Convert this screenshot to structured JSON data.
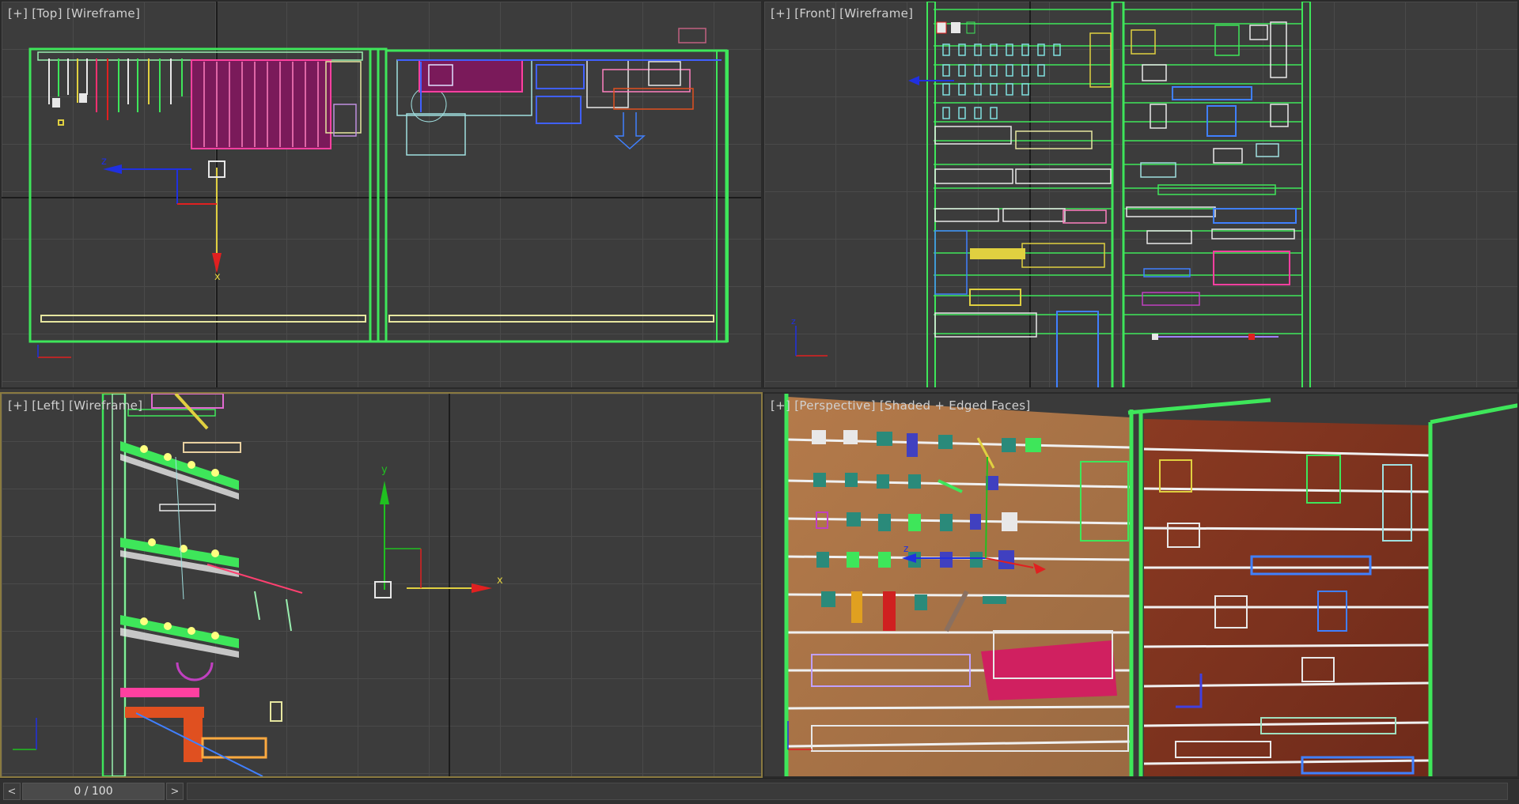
{
  "viewports": {
    "top": {
      "plus": "[+]",
      "view": "[Top]",
      "mode": "[Wireframe]"
    },
    "front": {
      "plus": "[+]",
      "view": "[Front]",
      "mode": "[Wireframe]"
    },
    "left": {
      "plus": "[+]",
      "view": "[Left]",
      "mode": "[Wireframe]"
    },
    "perspective": {
      "plus": "[+]",
      "view": "[Perspective]",
      "mode": "[Shaded + Edged Faces]"
    }
  },
  "gizmo_labels": {
    "x": "x",
    "y": "y",
    "z": "z"
  },
  "timeline": {
    "position": "0 / 100",
    "prev": "<",
    "next": ">"
  },
  "colors": {
    "viewport_bg": "#3c3c3c",
    "active_border": "#8a7a40",
    "wire_green": "#3ee65a",
    "wall_wood": "#a0643c",
    "gizmo_x": "#e02020",
    "gizmo_y": "#20c020",
    "gizmo_z": "#2030e0"
  }
}
